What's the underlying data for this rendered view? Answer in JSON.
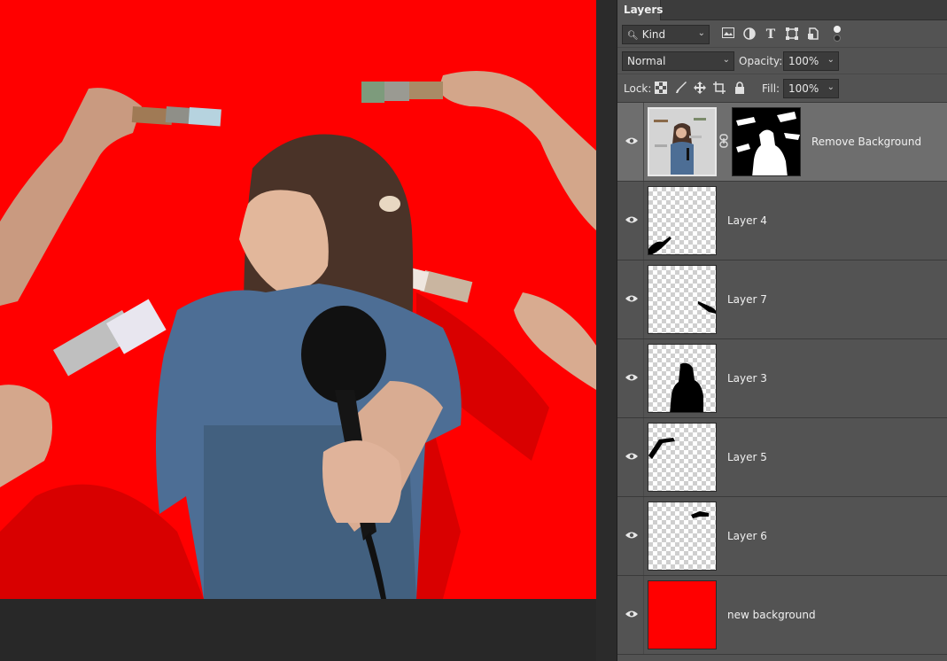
{
  "panel": {
    "tab_label": "Layers",
    "filter": {
      "value": "Kind",
      "icons": [
        "search-icon",
        "image-filter-icon",
        "adjustment-filter-icon",
        "type-filter-icon",
        "shape-filter-icon",
        "smart-object-filter-icon",
        "filter-toggle-icon"
      ]
    },
    "blend_mode": "Normal",
    "opacity_label": "Opacity:",
    "opacity_value": "100%",
    "lock_label": "Lock:",
    "lock_icons": [
      "lock-transparency-icon",
      "lock-pixels-icon",
      "lock-position-icon",
      "lock-artboard-icon",
      "lock-all-icon"
    ],
    "fill_label": "Fill:",
    "fill_value": "100%"
  },
  "layers": [
    {
      "name": "Remove Background",
      "selected": true,
      "has_mask": true
    },
    {
      "name": "Layer 4"
    },
    {
      "name": "Layer 7"
    },
    {
      "name": "Layer 3"
    },
    {
      "name": "Layer 5"
    },
    {
      "name": "Layer 6"
    },
    {
      "name": "new background"
    }
  ],
  "colors": {
    "background_red": "#ff0000",
    "panel_bg": "#535353",
    "selected_row": "#6e6e6e"
  }
}
